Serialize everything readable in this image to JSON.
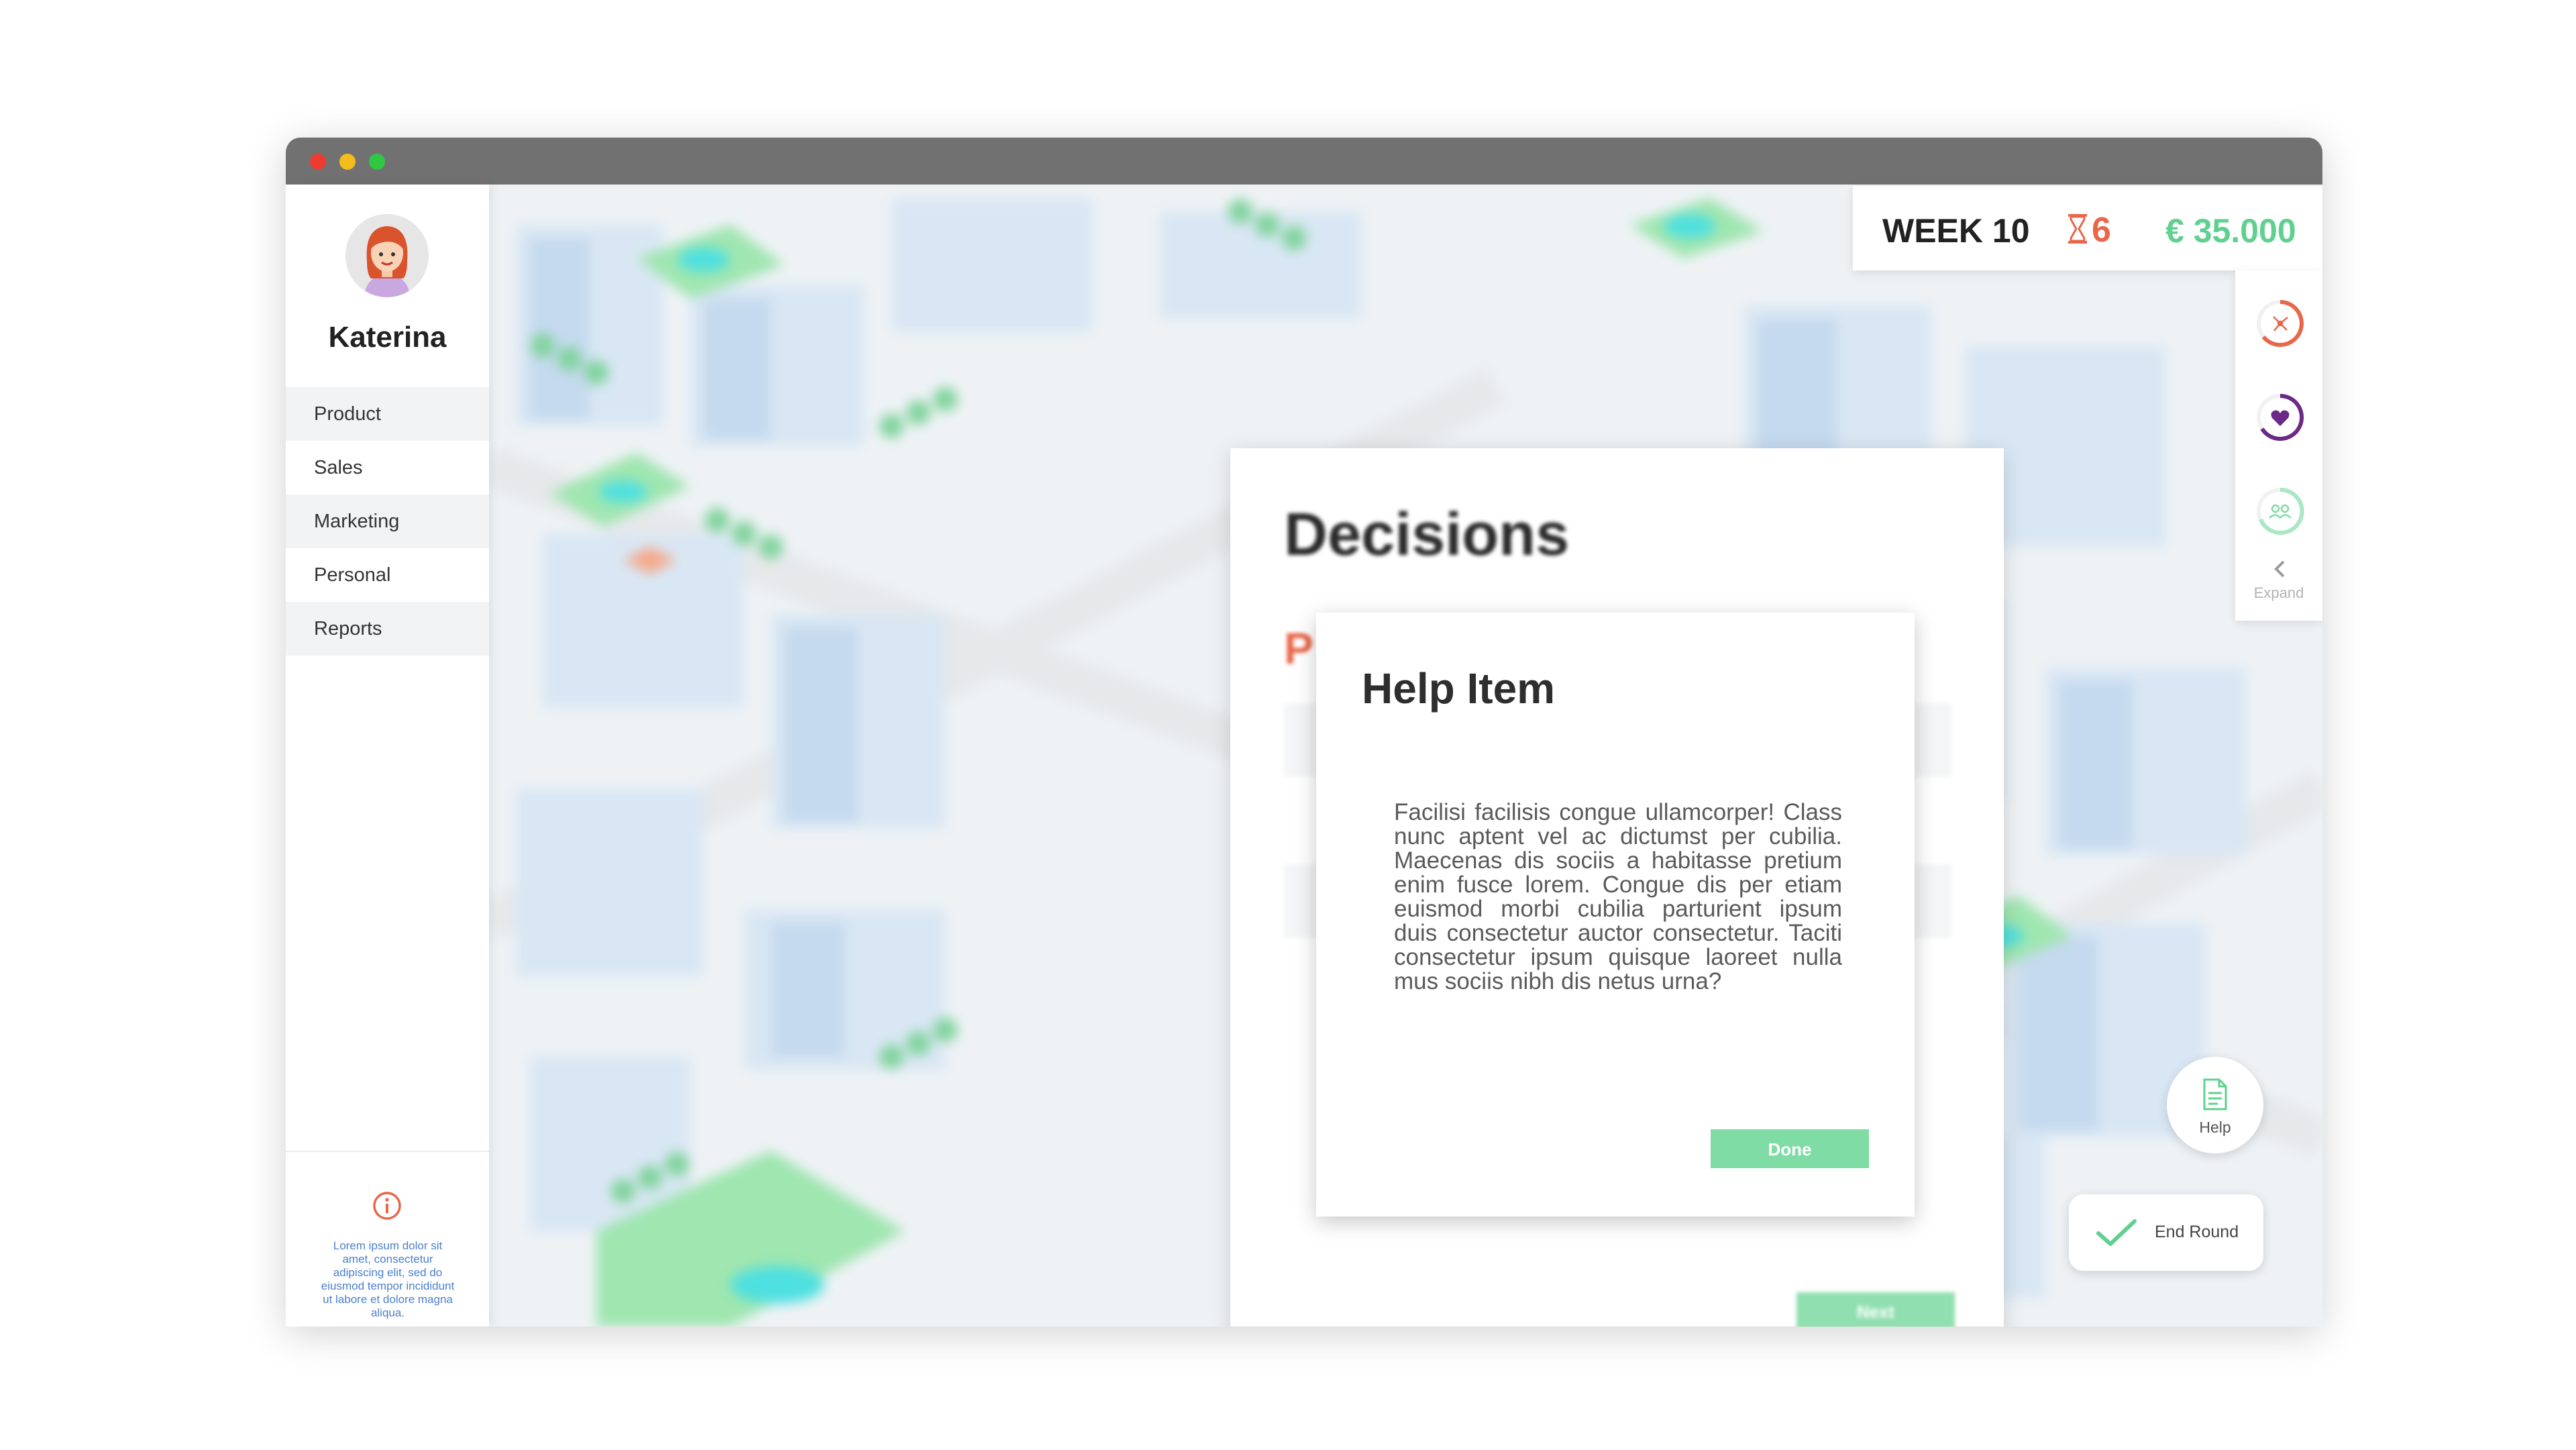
{
  "user": {
    "name": "Katerina"
  },
  "sidebar": {
    "items": [
      {
        "label": "Product"
      },
      {
        "label": "Sales"
      },
      {
        "label": "Marketing"
      },
      {
        "label": "Personal"
      },
      {
        "label": "Reports"
      }
    ],
    "info_text": "Lorem ipsum dolor sit amet, consectetur adipiscing elit, sed do eiusmod tempor incididunt ut labore et dolore magna aliqua."
  },
  "stats": {
    "week": "WEEK 10",
    "timer": "6",
    "money": "€ 35.000"
  },
  "metrics": {
    "items": [
      {
        "icon": "network-icon",
        "color": "#e8674a"
      },
      {
        "icon": "heart-icon",
        "color": "#6b2a86"
      },
      {
        "icon": "people-icon",
        "color": "#7fdca4"
      }
    ],
    "expand_label": "Expand"
  },
  "decisions": {
    "title": "Decisions",
    "subtitle": "P",
    "next_label": "Next"
  },
  "modal": {
    "title": "Help Item",
    "body": "Facilisi facilisis congue ullamcorper! Class nunc aptent vel ac dictumst per cubilia. Maecenas dis sociis a habitasse pretium enim fusce lorem. Congue dis per etiam euismod morbi cubilia parturient ipsum duis consectetur auctor consectetur. Taciti consectetur ipsum quisque laoreet nulla mus sociis nibh dis netus urna?",
    "done_label": "Done"
  },
  "help": {
    "label": "Help"
  },
  "end_round": {
    "label": "End Round"
  },
  "colors": {
    "accent_orange": "#e8674a",
    "accent_green": "#5fd08f",
    "button_green": "#7fdca4",
    "titlebar": "#717171"
  }
}
